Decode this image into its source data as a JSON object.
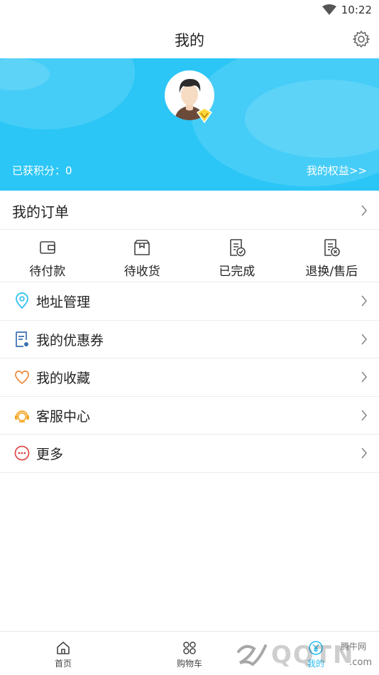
{
  "status_bar": {
    "time": "10:22",
    "wifi_icon": "wifi-icon"
  },
  "header": {
    "title": "我的",
    "settings_icon": "gear-icon"
  },
  "profile": {
    "points_label": "已获积分：0",
    "rights_link": "我的权益>>",
    "banner_color": "#2bc6f6"
  },
  "orders": {
    "title": "我的订单",
    "tabs": [
      {
        "label": "待付款",
        "icon": "wallet-icon"
      },
      {
        "label": "待收货",
        "icon": "box-icon"
      },
      {
        "label": "已完成",
        "icon": "completed-doc-icon"
      },
      {
        "label": "退换/售后",
        "icon": "refund-doc-icon"
      }
    ]
  },
  "menu": [
    {
      "label": "地址管理",
      "icon": "location-pin-icon",
      "color": "#2bbdf0"
    },
    {
      "label": "我的优惠券",
      "icon": "coupon-icon",
      "color": "#3a6fb0"
    },
    {
      "label": "我的收藏",
      "icon": "heart-icon",
      "color": "#f08a3c"
    },
    {
      "label": "客服中心",
      "icon": "headset-icon",
      "color": "#f5a623"
    },
    {
      "label": "更多",
      "icon": "more-dots-icon",
      "color": "#e04848"
    }
  ],
  "tab_bar": [
    {
      "label": "首页",
      "icon": "home-icon"
    },
    {
      "label": "购物车",
      "icon": "cart-grid-icon"
    },
    {
      "label": "我的",
      "icon": "wallet-yen-icon",
      "active": true
    }
  ],
  "watermark": {
    "text": "QQTN",
    "small": "腾牛网",
    "suffix": ".com"
  }
}
